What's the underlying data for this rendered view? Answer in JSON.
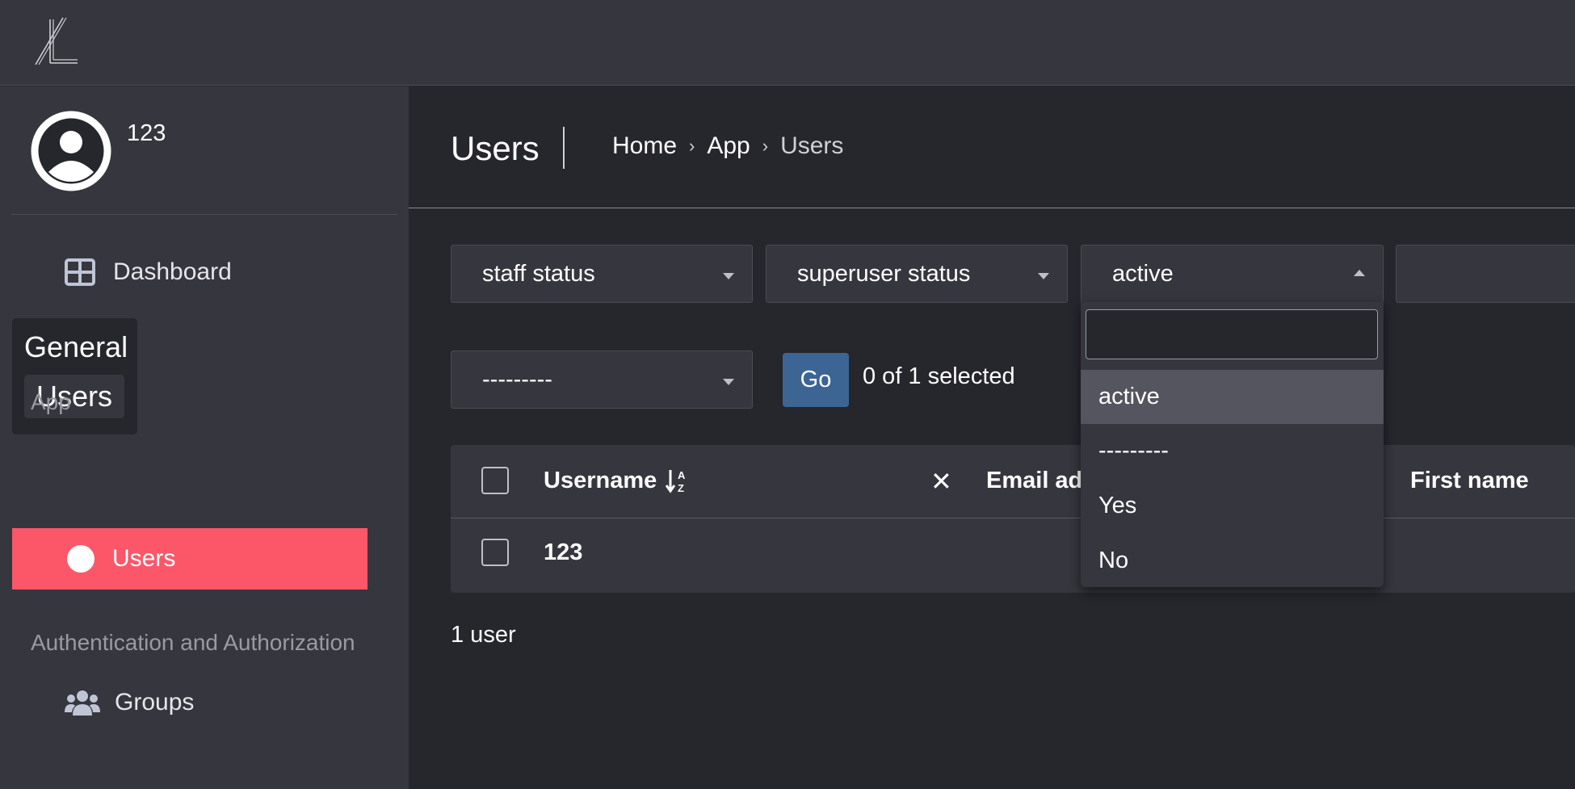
{
  "sidebar": {
    "user_name": "123",
    "dashboard_label": "Dashboard",
    "recent": {
      "title": "General",
      "item": "Users"
    },
    "section_app": "App",
    "users_label": "Users",
    "section_auth": "Authentication and Authorization",
    "groups_label": "Groups"
  },
  "header": {
    "title": "Users",
    "breadcrumb": {
      "home": "Home",
      "app": "App",
      "current": "Users",
      "separator": "›"
    }
  },
  "filters": {
    "staff": "staff status",
    "superuser": "superuser status",
    "active": "active"
  },
  "actions": {
    "select_value": "---------",
    "go_label": "Go",
    "selected_count": "0 of 1 selected"
  },
  "table": {
    "headers": {
      "username": "Username",
      "email": "Email ad",
      "first_name": "First name"
    },
    "rows": [
      {
        "username": "123"
      }
    ]
  },
  "result_count": "1 user",
  "dropdown": {
    "search_placeholder": "",
    "options": [
      "active",
      "---------",
      "Yes",
      "No"
    ],
    "highlighted": "active"
  },
  "colors": {
    "accent": "#fc5769",
    "button": "#3d6593",
    "background": "#26262d",
    "panel": "#36363e"
  }
}
